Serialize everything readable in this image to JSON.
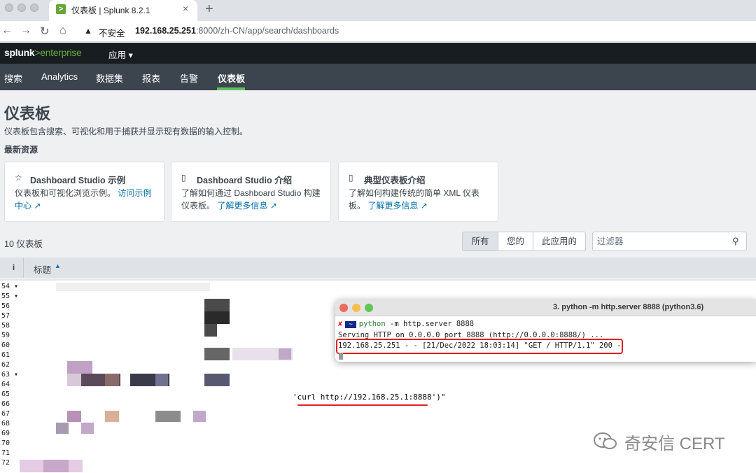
{
  "browser": {
    "tab_title": "仪表板 | Splunk 8.2.1",
    "tab_close": "×",
    "new_tab": "+",
    "insecure_label": "不安全",
    "url_host": "192.168.25.251",
    "url_path": ":8000/zh-CN/app/search/dashboards"
  },
  "splunk": {
    "logo_main": "splunk",
    "logo_gt": ">",
    "logo_ent": "enterprise",
    "app_menu": "应用 ▾",
    "nav": [
      "搜索",
      "Analytics",
      "数据集",
      "报表",
      "告警",
      "仪表板"
    ],
    "active_nav": "仪表板"
  },
  "page": {
    "title": "仪表板",
    "description": "仪表板包含搜索、可视化和用于捕获并显示现有数据的输入控制。",
    "section": "最新资源",
    "cards": [
      {
        "icon": "☆",
        "icon_name": "star-icon",
        "title": "Dashboard Studio 示例",
        "body": "仪表板和可视化浏览示例。",
        "link": "访问示例中心 ↗"
      },
      {
        "icon": "▯",
        "icon_name": "book-icon",
        "title": "Dashboard Studio 介绍",
        "body": "了解如何通过 Dashboard Studio 构建仪表板。",
        "link": "了解更多信息 ↗"
      },
      {
        "icon": "▯",
        "icon_name": "book-icon",
        "title": "典型仪表板介绍",
        "body": "了解如何构建传统的简单 XML 仪表板。",
        "link": "了解更多信息 ↗"
      }
    ],
    "count": "10 仪表板",
    "filter_tabs": [
      "所有",
      "您的",
      "此应用的"
    ],
    "filter_placeholder": "过滤器",
    "table_header_i": "i",
    "table_header_title": "标题",
    "sort_indicator": "▲"
  },
  "editor": {
    "line_numbers": [
      "54 ▾",
      "55 ▾",
      "56",
      "57",
      "58",
      "59",
      "60",
      "61",
      "62",
      "63 ▾",
      "64",
      "65",
      "66",
      "67",
      "68",
      "69",
      "70",
      "71",
      "72"
    ],
    "curl_line": "'curl http://192.168.25.1:8888')\""
  },
  "terminal": {
    "title": "3. python -m http.server 8888 (python3.6)",
    "prompt_x": "✘",
    "prompt_seg": "~",
    "command": "python",
    "command_args": " -m http.server 8888",
    "serving": "Serving HTTP on 0.0.0.0 port 8888 (http://0.0.0.0:8888/) ...",
    "request_log": "192.168.25.251 - - [21/Dec/2022 18:03:14] \"GET / HTTP/1.1\" 200 -"
  },
  "watermark": "奇安信 CERT",
  "colors": {
    "splunk_dark": "#171d21",
    "splunk_nav": "#3c444d",
    "splunk_green": "#65a637",
    "link_blue": "#006eaa",
    "highlight_red": "#e02020"
  }
}
